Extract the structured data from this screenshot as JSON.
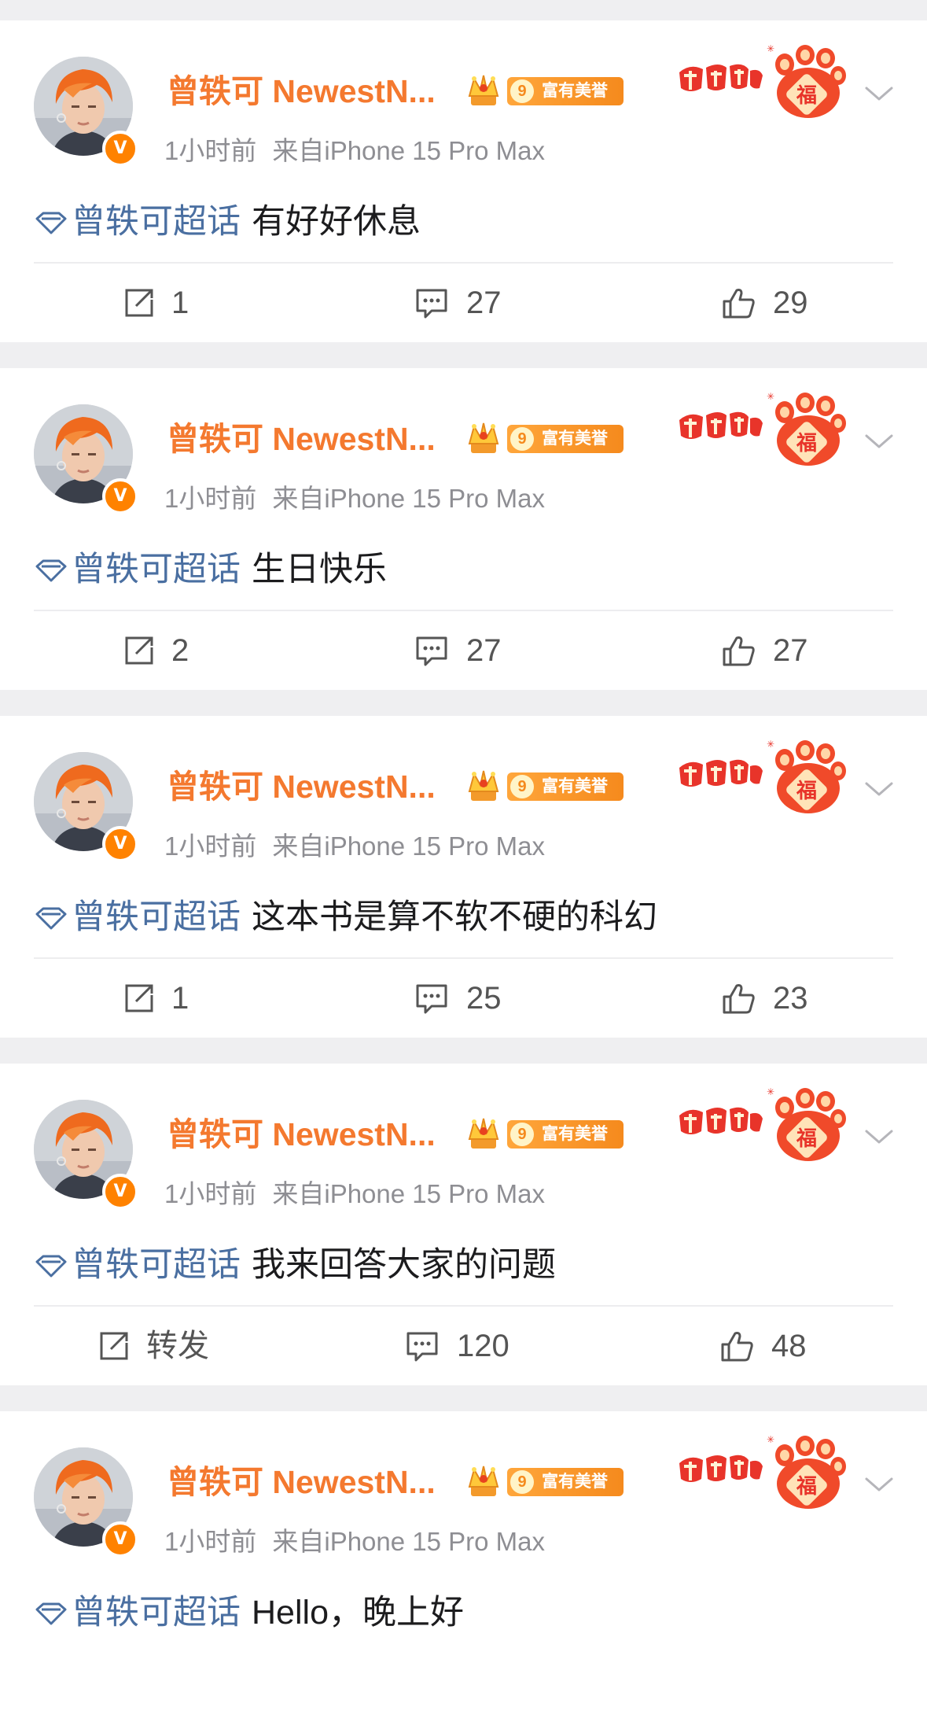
{
  "posts": [
    {
      "author": "曾轶可 NewestN...",
      "vip_level": "9",
      "vip_label": "富有美誉",
      "time": "1小时前",
      "source": "来自iPhone 15 Pro Max",
      "topic": "曾轶可超话",
      "text": "有好好休息",
      "reposts": "1",
      "comments": "27",
      "likes": "29"
    },
    {
      "author": "曾轶可 NewestN...",
      "vip_level": "9",
      "vip_label": "富有美誉",
      "time": "1小时前",
      "source": "来自iPhone 15 Pro Max",
      "topic": "曾轶可超话",
      "text": "生日快乐",
      "reposts": "2",
      "comments": "27",
      "likes": "27"
    },
    {
      "author": "曾轶可 NewestN...",
      "vip_level": "9",
      "vip_label": "富有美誉",
      "time": "1小时前",
      "source": "来自iPhone 15 Pro Max",
      "topic": "曾轶可超话",
      "text": "这本书是算不软不硬的科幻",
      "reposts": "1",
      "comments": "25",
      "likes": "23"
    },
    {
      "author": "曾轶可 NewestN...",
      "vip_level": "9",
      "vip_label": "富有美誉",
      "time": "1小时前",
      "source": "来自iPhone 15 Pro Max",
      "topic": "曾轶可超话",
      "text": "我来回答大家的问题",
      "reposts": "转发",
      "comments": "120",
      "likes": "48"
    },
    {
      "author": "曾轶可 NewestN...",
      "vip_level": "9",
      "vip_label": "富有美誉",
      "time": "1小时前",
      "source": "来自iPhone 15 Pro Max",
      "topic": "曾轶可超话",
      "text": "Hello，晚上好",
      "reposts": "",
      "comments": "",
      "likes": ""
    }
  ],
  "icons": {
    "repost": "repost-icon",
    "comment": "comment-icon",
    "like": "thumbs-up-icon",
    "topic": "super-topic-diamond-icon",
    "verified": "verified-v-icon",
    "crown": "crown-icon",
    "sticker": "tiger-paw-sticker-icon",
    "more": "chevron-down-icon"
  },
  "colors": {
    "author_name": "#f4792f",
    "topic_link": "#4a6fa1",
    "verified_badge": "#ff8200",
    "meta_text": "#8e8e93",
    "background": "#efeff1"
  }
}
